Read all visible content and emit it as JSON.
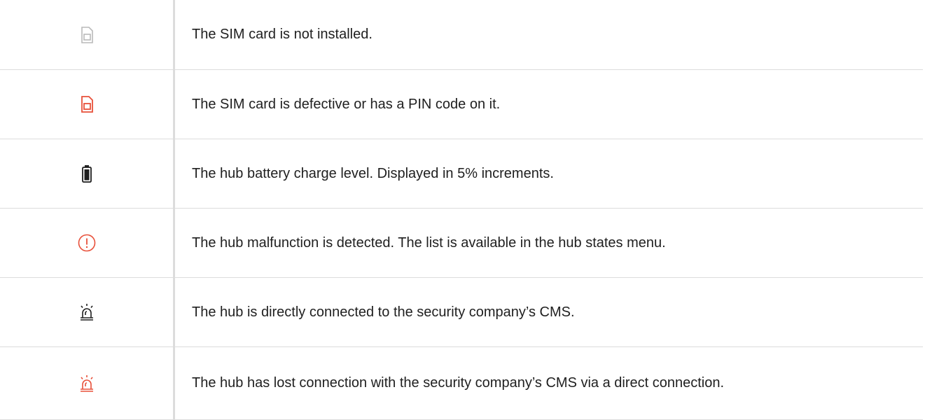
{
  "colors": {
    "muted": "#b9b9b9",
    "alert": "#e8503a",
    "dark": "#1f1f1f"
  },
  "rows": [
    {
      "icon": "sim-card-muted-icon",
      "text": "The SIM card is not installed."
    },
    {
      "icon": "sim-card-red-icon",
      "text": "The SIM card is defective or has a PIN code on it."
    },
    {
      "icon": "battery-icon",
      "text": "The hub battery charge level. Displayed in 5% increments."
    },
    {
      "icon": "malfunction-exclamation-icon",
      "text": "The hub malfunction is detected. The list is available in the hub states menu."
    },
    {
      "icon": "siren-connected-icon",
      "text": "The hub is directly connected to the security company’s CMS."
    },
    {
      "icon": "siren-lost-icon",
      "text": "The hub has lost connection with the security company’s CMS via a direct connection."
    }
  ]
}
